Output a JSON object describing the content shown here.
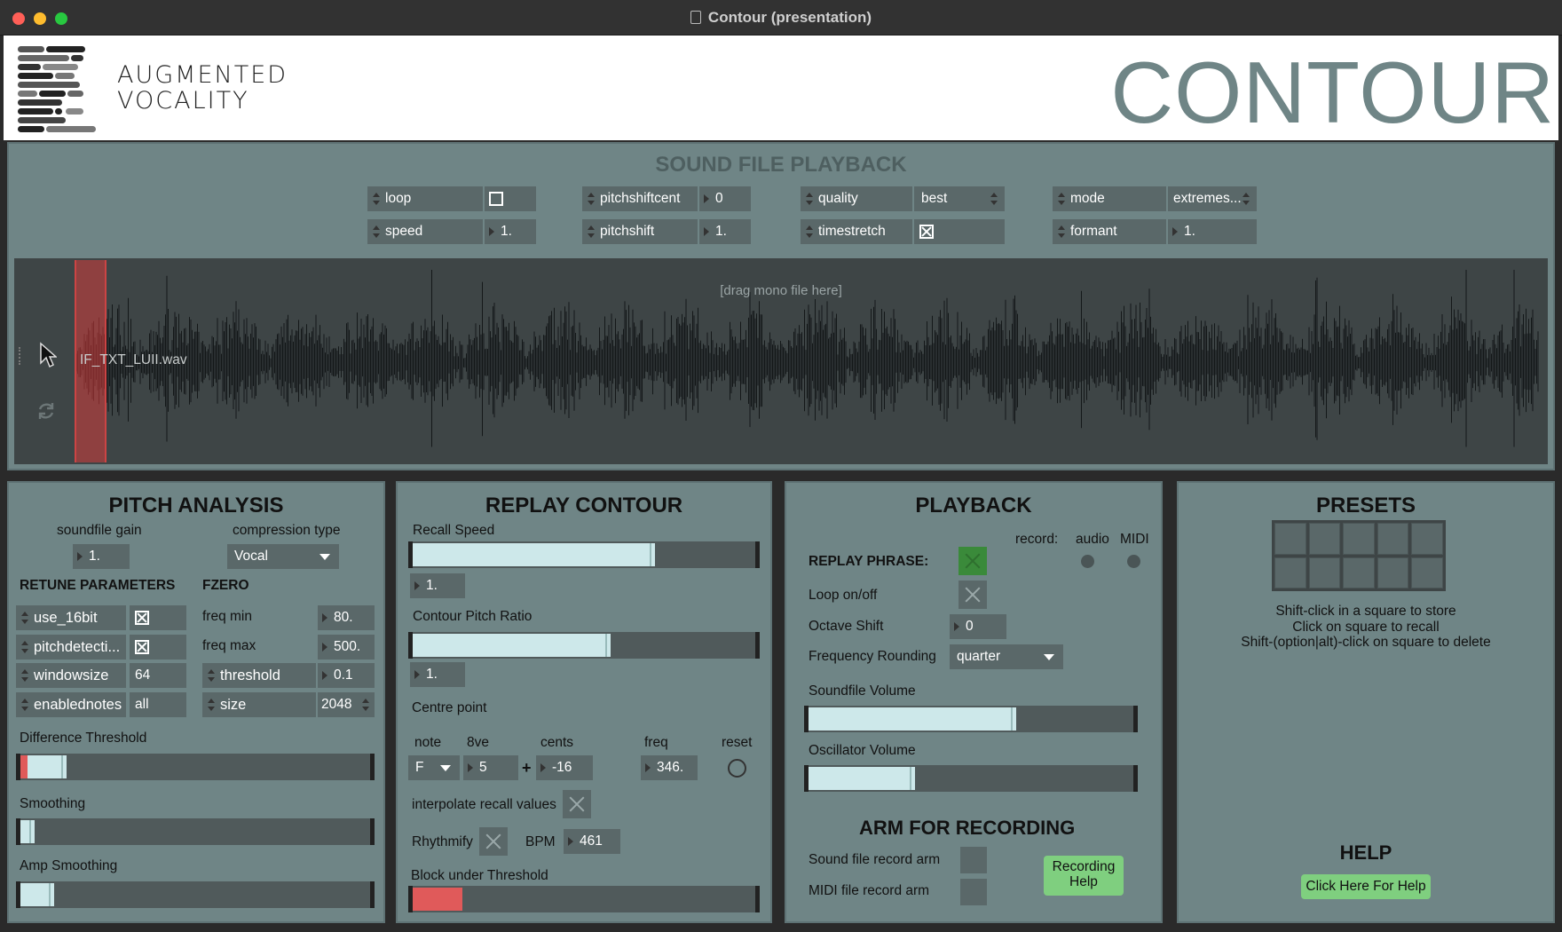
{
  "window": {
    "title": "Contour (presentation)"
  },
  "header": {
    "brand_line1": "AUGMENTED",
    "brand_line2": "VOCALITY",
    "app_title": "CONTOUR"
  },
  "sound_file": {
    "title": "SOUND FILE PLAYBACK",
    "attrs": {
      "loop_label": "loop",
      "speed_label": "speed",
      "speed_value": "1.",
      "pitchshiftcent_label": "pitchshiftcent",
      "pitchshiftcent_value": "0",
      "pitchshift_label": "pitchshift",
      "pitchshift_value": "1.",
      "quality_label": "quality",
      "quality_value": "best",
      "timestretch_label": "timestretch",
      "mode_label": "mode",
      "mode_value": "extremes...",
      "formant_label": "formant",
      "formant_value": "1."
    },
    "drop_hint": "[drag mono file here]",
    "file_name": "IF_TXT_LUII.wav"
  },
  "pitch_analysis": {
    "title": "PITCH ANALYSIS",
    "soundfile_gain_label": "soundfile gain",
    "soundfile_gain_value": "1.",
    "compression_type_label": "compression type",
    "compression_type_value": "Vocal",
    "retune_label": "RETUNE PARAMETERS",
    "fzero_label": "FZERO",
    "use_16bit_label": "use_16bit",
    "pitchdetection_label": "pitchdetecti...",
    "windowsize_label": "windowsize",
    "windowsize_value": "64",
    "enablednotes_label": "enablednotes",
    "enablednotes_value": "all",
    "freq_min_label": "freq min",
    "freq_min_value": "80.",
    "freq_max_label": "freq max",
    "freq_max_value": "500.",
    "threshold_label": "threshold",
    "threshold_value": "0.1",
    "size_label": "size",
    "size_value": "2048",
    "difference_threshold_label": "Difference Threshold",
    "smoothing_label": "Smoothing",
    "amp_smoothing_label": "Amp Smoothing"
  },
  "replay_contour": {
    "title": "REPLAY CONTOUR",
    "recall_speed_label": "Recall Speed",
    "recall_speed_value": "1.",
    "recall_speed_level": 0.7,
    "pitch_ratio_label": "Contour Pitch Ratio",
    "pitch_ratio_value": "1.",
    "pitch_ratio_level": 0.57,
    "centre_point_label": "Centre point",
    "note_label": "note",
    "octave_label": "8ve",
    "cents_label": "cents",
    "freq_label": "freq",
    "reset_label": "reset",
    "note_value": "F",
    "octave_value": "5",
    "plus_sign": "+",
    "cents_value": "-16",
    "freq_value": "346.",
    "interpolate_label": "interpolate recall values",
    "rhythmify_label": "Rhythmify",
    "bpm_label": "BPM",
    "bpm_value": "461",
    "block_label": "Block under Threshold"
  },
  "playback": {
    "title": "PLAYBACK",
    "record_label": "record:",
    "audio_label": "audio",
    "midi_label": "MIDI",
    "replay_phrase_label": "REPLAY PHRASE:",
    "loop_label": "Loop on/off",
    "octave_shift_label": "Octave Shift",
    "octave_shift_value": "0",
    "freq_rounding_label": "Frequency Rounding",
    "freq_rounding_value": "quarter",
    "soundfile_volume_label": "Soundfile Volume",
    "soundfile_volume_level": 0.63,
    "oscillator_volume_label": "Oscillator Volume",
    "oscillator_volume_level": 0.32,
    "arm_title": "ARM FOR RECORDING",
    "sound_arm_label": "Sound file record arm",
    "midi_arm_label": "MIDI file record arm",
    "recording_help_line1": "Recording",
    "recording_help_line2": "Help"
  },
  "presets": {
    "title": "PRESETS",
    "hint1": "Shift-click in a square to store",
    "hint2": "Click on square to recall",
    "hint3": "Shift-(option|alt)-click on square to delete",
    "help_title": "HELP",
    "help_button": "Click Here For Help"
  },
  "colors": {
    "panel": "#6f8586",
    "slider_fill": "#cde8ea",
    "accent_red": "#e05a5a",
    "title_gray": "#6f8586",
    "help_green": "#7fcf7f"
  }
}
